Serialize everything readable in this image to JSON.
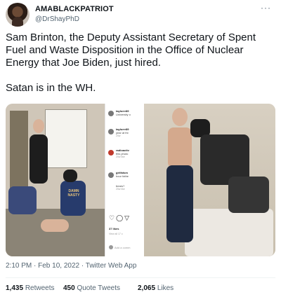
{
  "author": {
    "display_name": "AMABLACKPATRIOT",
    "handle": "@DrShayPhD",
    "avatar_icon": "profile-photo"
  },
  "more_label": "···",
  "tweet_text": {
    "line1": "Sam Brinton, the Deputy Assistant Secretary of Spent Fuel and Waste Disposition in the Office of Nuclear Energy that Joe Biden, just hired.",
    "line2": "Satan is in the WH."
  },
  "media": {
    "collage": [
      {
        "panel": "photo-left",
        "text": "DAMN NASTY"
      },
      {
        "panel": "instagram-screenshot",
        "comments": [
          {
            "user": "taylorrr89",
            "text": "University o",
            "time": ""
          },
          {
            "user": "taylorrr89",
            "text": "year at thi",
            "time": "20w"
          },
          {
            "user": "radioactiv",
            "text": "this photo",
            "time": "20w  like"
          },
          {
            "user": "girlfatsm",
            "text": "hour fathe",
            "time": ""
          },
          {
            "user": "",
            "text": "bears?",
            "time": "20w  like"
          }
        ],
        "likes": "37 likes",
        "view_label": "View all 17 c",
        "add_comment": "Add a comm"
      },
      {
        "panel": "photo-right"
      }
    ]
  },
  "timestamp": "2:10 PM · Feb 10, 2022 · Twitter Web App",
  "stats": {
    "retweets_count": "1,435",
    "retweets_label": "Retweets",
    "quote_count": "450",
    "quote_label": "Quote Tweets",
    "likes_count": "2,065",
    "likes_label": "Likes"
  }
}
